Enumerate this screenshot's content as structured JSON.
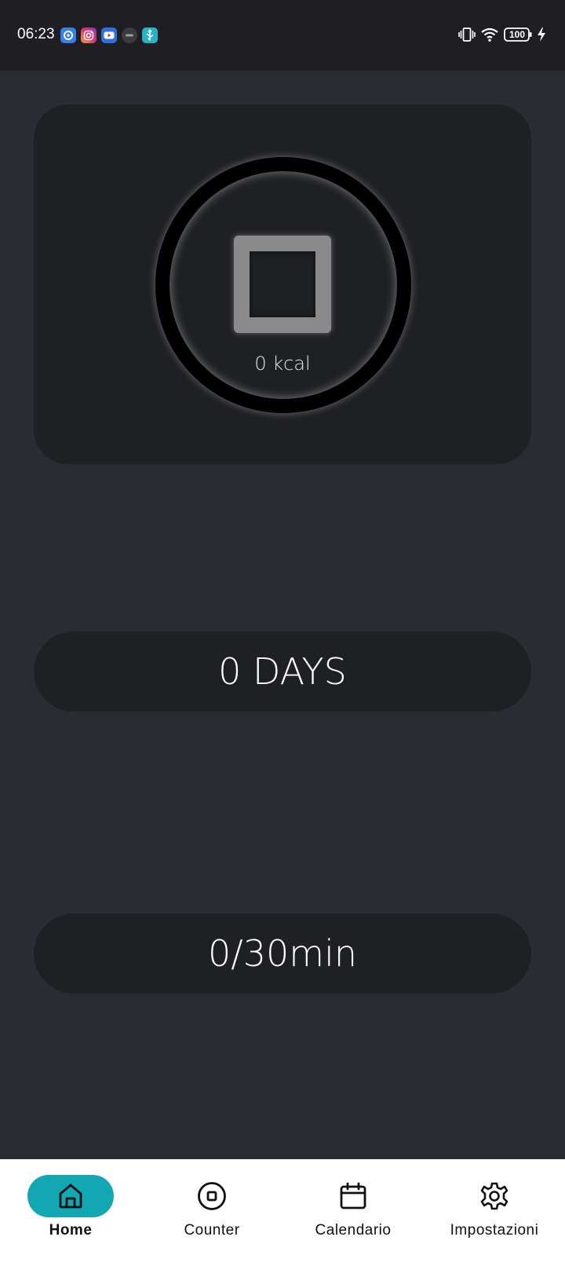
{
  "status_bar": {
    "time": "06:23",
    "battery_level": "100",
    "notification_icons": [
      "settings-app-icon",
      "instagram-icon",
      "youtube-icon",
      "app-icon",
      "usb-icon"
    ]
  },
  "workout": {
    "calories_label": "0 kcal",
    "ring_progress": 0,
    "control_state": "stop"
  },
  "streak": {
    "days_label": "0 DAYS"
  },
  "activity": {
    "minutes_label": "0/30min"
  },
  "colors": {
    "background": "#2b2c31",
    "card": "#1f2024",
    "status_bar": "#1f1f23",
    "accent": "#12a7b3",
    "nav_background": "#ffffff"
  },
  "nav": {
    "items": [
      {
        "label": "Home",
        "icon": "home-icon",
        "active": true
      },
      {
        "label": "Counter",
        "icon": "stop-circle-icon",
        "active": false
      },
      {
        "label": "Calendario",
        "icon": "calendar-icon",
        "active": false
      },
      {
        "label": "Impostazioni",
        "icon": "gear-icon",
        "active": false
      }
    ]
  }
}
